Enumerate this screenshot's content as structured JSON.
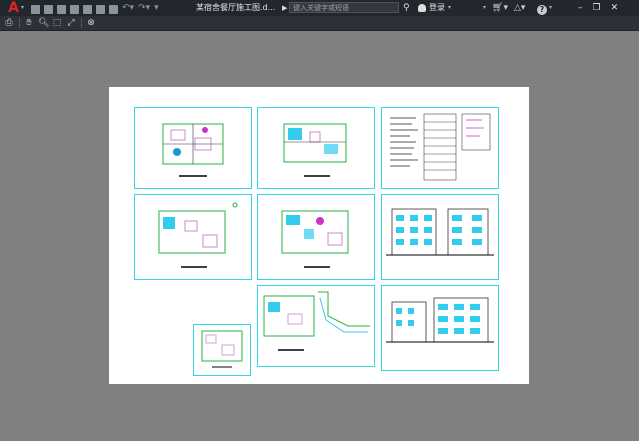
{
  "app": {
    "logo_letter": "A",
    "document_title": "某宿舍餐厅施工图.d...",
    "search_placeholder": "键入关键字或短语",
    "user_label": "登录",
    "help_label": "?",
    "window_buttons": {
      "minimize": "–",
      "restore": "❐",
      "close": "✕"
    }
  },
  "quick_access": [
    "new-icon",
    "open-icon",
    "save-icon",
    "save-as-icon",
    "open-web-icon",
    "save-web-icon",
    "plot-icon",
    "undo-icon",
    "redo-icon",
    "customize-icon"
  ],
  "preview_toolbar": [
    "print-icon",
    "pan-icon",
    "zoom-icon",
    "zoom-window-icon",
    "zoom-extents-icon",
    "close-preview-icon"
  ],
  "colors": {
    "title_bar": "#22272d",
    "toolbar": "#2e3238",
    "canvas": "#808080",
    "paper": "#ffffff",
    "frame": "#33d6e6",
    "accent_red": "#d9242a"
  },
  "sheets": [
    {
      "name": "floor-plan-1",
      "kind": "plan"
    },
    {
      "name": "floor-plan-2",
      "kind": "plan"
    },
    {
      "name": "design-notes",
      "kind": "notes"
    },
    {
      "name": "floor-plan-3",
      "kind": "plan"
    },
    {
      "name": "floor-plan-4",
      "kind": "plan"
    },
    {
      "name": "elevations-1",
      "kind": "elevation"
    },
    {
      "name": "detail-small",
      "kind": "detail"
    },
    {
      "name": "site-plan",
      "kind": "site"
    },
    {
      "name": "elevations-2",
      "kind": "elevation"
    }
  ]
}
